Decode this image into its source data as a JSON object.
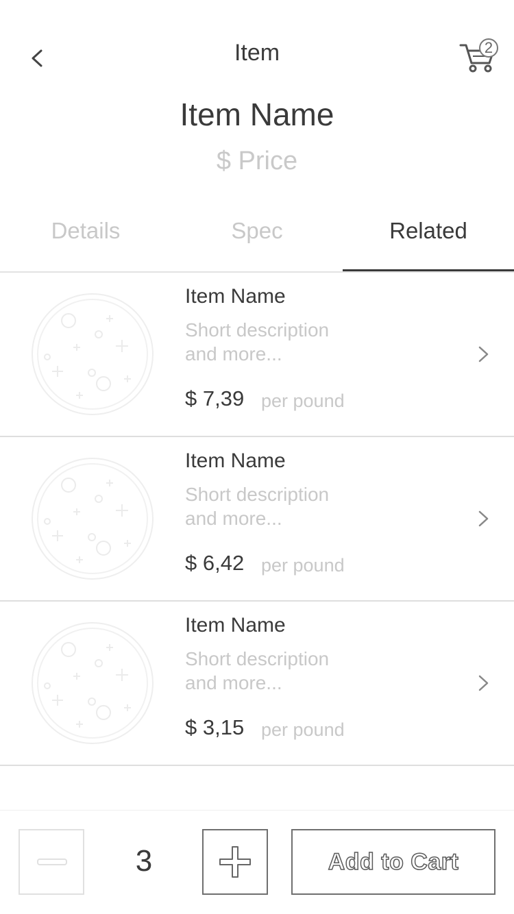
{
  "header": {
    "title": "Item",
    "cart_count": "2"
  },
  "item": {
    "name": "Item Name",
    "price": "$ Price"
  },
  "tabs": [
    {
      "label": "Details",
      "active": false
    },
    {
      "label": "Spec",
      "active": false
    },
    {
      "label": "Related",
      "active": true
    }
  ],
  "related": [
    {
      "name": "Item Name",
      "desc_line1": "Short description",
      "desc_line2": "and more...",
      "price": "$ 7,39",
      "unit": "per pound"
    },
    {
      "name": "Item Name",
      "desc_line1": "Short description",
      "desc_line2": "and more...",
      "price": "$ 6,42",
      "unit": "per pound"
    },
    {
      "name": "Item Name",
      "desc_line1": "Short description",
      "desc_line2": "and more...",
      "price": "$ 3,15",
      "unit": "per pound"
    }
  ],
  "footer": {
    "quantity": "3",
    "add_to_cart_label": "Add to Cart"
  },
  "icons": {
    "back": "chevron-left-icon",
    "cart": "cart-icon",
    "row_arrow": "chevron-right-icon",
    "thumb": "pizza-icon",
    "minus": "minus-icon",
    "plus": "plus-icon"
  }
}
